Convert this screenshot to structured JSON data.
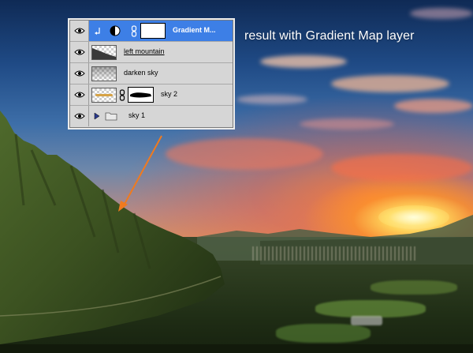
{
  "caption": "result with Gradient Map layer",
  "layers_panel": {
    "layers": [
      {
        "name": "Gradient M...",
        "selected": true,
        "type": "adjustment",
        "icons": [
          "clip-arrow-icon",
          "adjustment-icon",
          "chain-link-icon",
          "layer-mask-thumbnail"
        ]
      },
      {
        "name": "left mountain",
        "selected": false,
        "type": "pixel"
      },
      {
        "name": "darken sky",
        "selected": false,
        "type": "pixel"
      },
      {
        "name": "sky 2",
        "selected": false,
        "type": "pixel-with-mask"
      },
      {
        "name": "sky 1",
        "selected": false,
        "type": "group"
      }
    ]
  },
  "colors": {
    "selected_row": "#3d7fe6",
    "panel_bg": "#d6d6d6",
    "arrow": "#f07a1e"
  }
}
